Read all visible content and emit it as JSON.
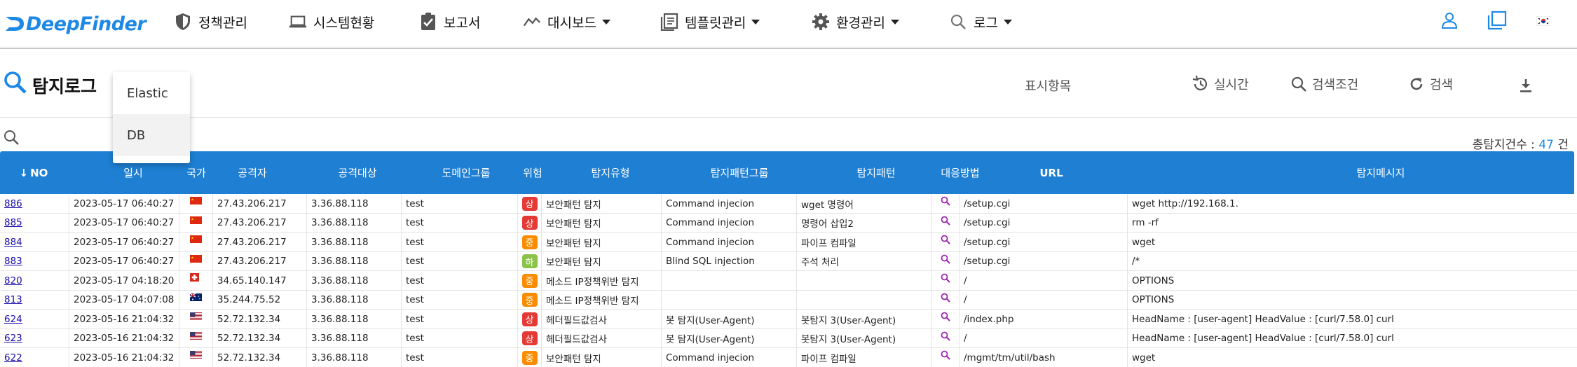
{
  "app": {
    "logo_text": "DeepFinder"
  },
  "nav": [
    {
      "label": "정책관리",
      "icon": "shield-icon",
      "caret": false
    },
    {
      "label": "시스템현황",
      "icon": "laptop-icon",
      "caret": false
    },
    {
      "label": "보고서",
      "icon": "clipboard-check-icon",
      "caret": false
    },
    {
      "label": "대시보드",
      "icon": "trend-chart-icon",
      "caret": true
    },
    {
      "label": "템플릿관리",
      "icon": "template-icon",
      "caret": true
    },
    {
      "label": "환경관리",
      "icon": "gear-icon",
      "caret": true
    },
    {
      "label": "로그",
      "icon": "search-icon",
      "caret": true
    }
  ],
  "page": {
    "title": "탐지로그",
    "total_label": "총탐지건수 : ",
    "total_count": "47",
    "total_unit": " 건"
  },
  "toolbar": {
    "display_items": "표시항목",
    "realtime": "실시간",
    "search_conditions": "검색조건",
    "search": "검색"
  },
  "dropdown": {
    "items": [
      "Elastic",
      "DB"
    ],
    "selected": "DB"
  },
  "table": {
    "columns": [
      "NO",
      "일시",
      "국가",
      "공격자",
      "공격대상",
      "도메인그룹",
      "위험",
      "탐지유형",
      "탐지패턴그룹",
      "탐지패턴",
      "대응방법",
      "URL",
      "탐지메시지"
    ],
    "sort_indicator": "↓",
    "rows": [
      {
        "no": "886",
        "time": "2023-05-17 06:40:27",
        "flag": "cn",
        "attacker": "27.43.206.217",
        "target": "3.36.88.118",
        "domain": "test",
        "risk": "상",
        "risk_color": "#e53935",
        "type": "보안패턴 탐지",
        "pgroup": "Command injecion",
        "pattern": "wget 명령어",
        "url": "/setup.cgi",
        "msg": "wget http://192.168.1."
      },
      {
        "no": "885",
        "time": "2023-05-17 06:40:27",
        "flag": "cn",
        "attacker": "27.43.206.217",
        "target": "3.36.88.118",
        "domain": "test",
        "risk": "상",
        "risk_color": "#e53935",
        "type": "보안패턴 탐지",
        "pgroup": "Command injecion",
        "pattern": "명령어 삽입2",
        "url": "/setup.cgi",
        "msg": "rm -rf"
      },
      {
        "no": "884",
        "time": "2023-05-17 06:40:27",
        "flag": "cn",
        "attacker": "27.43.206.217",
        "target": "3.36.88.118",
        "domain": "test",
        "risk": "중",
        "risk_color": "#fb8c00",
        "type": "보안패턴 탐지",
        "pgroup": "Command injecion",
        "pattern": "파이프 컴파일",
        "url": "/setup.cgi",
        "msg": "wget"
      },
      {
        "no": "883",
        "time": "2023-05-17 06:40:27",
        "flag": "cn",
        "attacker": "27.43.206.217",
        "target": "3.36.88.118",
        "domain": "test",
        "risk": "하",
        "risk_color": "#8bc34a",
        "type": "보안패턴 탐지",
        "pgroup": "Blind SQL injection",
        "pattern": "주석 처리",
        "url": "/setup.cgi",
        "msg": "/*"
      },
      {
        "no": "820",
        "time": "2023-05-17 04:18:20",
        "flag": "ch",
        "attacker": "34.65.140.147",
        "target": "3.36.88.118",
        "domain": "test",
        "risk": "중",
        "risk_color": "#fb8c00",
        "type": "메소드 IP정책위반 탐지",
        "pgroup": "",
        "pattern": "",
        "url": "/",
        "msg": "OPTIONS"
      },
      {
        "no": "813",
        "time": "2023-05-17 04:07:08",
        "flag": "au",
        "attacker": "35.244.75.52",
        "target": "3.36.88.118",
        "domain": "test",
        "risk": "중",
        "risk_color": "#fb8c00",
        "type": "메소드 IP정책위반 탐지",
        "pgroup": "",
        "pattern": "",
        "url": "/",
        "msg": "OPTIONS"
      },
      {
        "no": "624",
        "time": "2023-05-16 21:04:32",
        "flag": "us",
        "attacker": "52.72.132.34",
        "target": "3.36.88.118",
        "domain": "test",
        "risk": "상",
        "risk_color": "#e53935",
        "type": "헤더필드값검사",
        "pgroup": "봇 탐지(User-Agent)",
        "pattern": "봇탐지 3(User-Agent)",
        "url": "/index.php",
        "msg": "HeadName : [user-agent] HeadValue : [curl/7.58.0] curl"
      },
      {
        "no": "623",
        "time": "2023-05-16 21:04:32",
        "flag": "us",
        "attacker": "52.72.132.34",
        "target": "3.36.88.118",
        "domain": "test",
        "risk": "상",
        "risk_color": "#e53935",
        "type": "헤더필드값검사",
        "pgroup": "봇 탐지(User-Agent)",
        "pattern": "봇탐지 3(User-Agent)",
        "url": "/",
        "msg": "HeadName : [user-agent] HeadValue : [curl/7.58.0] curl"
      },
      {
        "no": "622",
        "time": "2023-05-16 21:04:32",
        "flag": "us",
        "attacker": "52.72.132.34",
        "target": "3.36.88.118",
        "domain": "test",
        "risk": "중",
        "risk_color": "#fb8c00",
        "type": "보안패턴 탐지",
        "pgroup": "Command injecion",
        "pattern": "파이프 컴파일",
        "url": "/mgmt/tm/util/bash",
        "msg": "wget"
      }
    ]
  },
  "colors": {
    "accent": "#1e7fd3",
    "link": "#1a0dab",
    "magnifier": "#9c27b0"
  }
}
